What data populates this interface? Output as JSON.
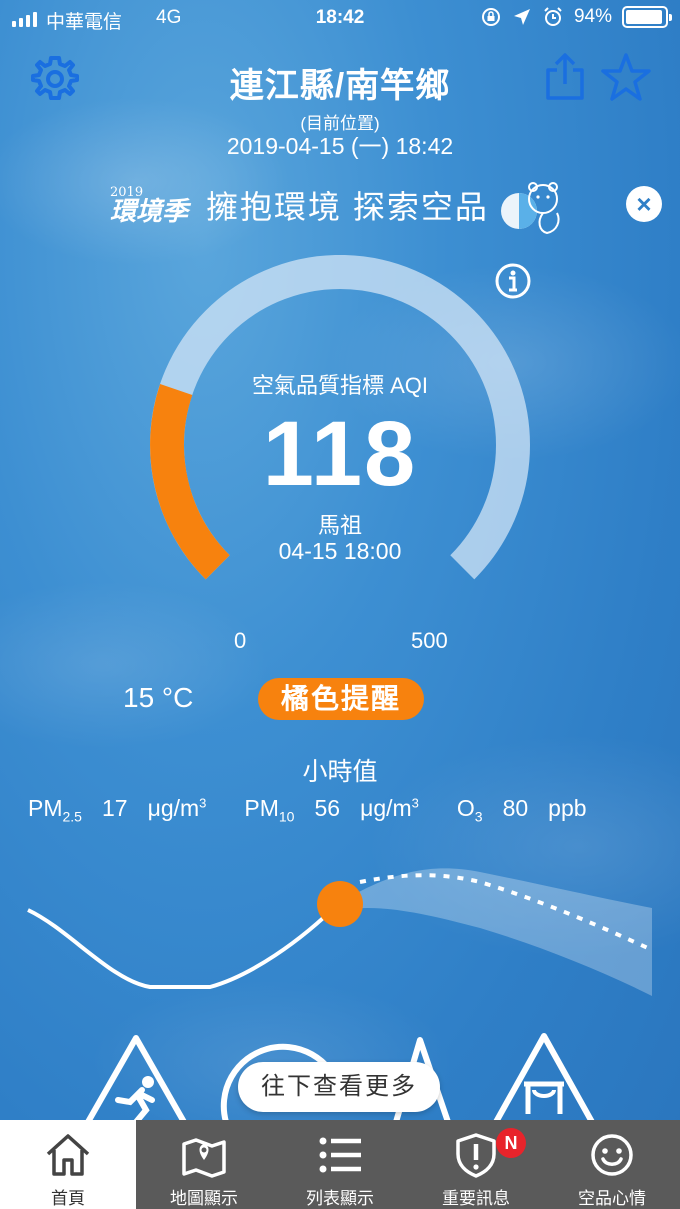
{
  "status_bar": {
    "carrier": "中華電信",
    "network": "4G",
    "time": "18:42",
    "battery": "94%",
    "battery_level": 0.94
  },
  "header": {
    "title": "連江縣/南竿鄉",
    "location_note": "(目前位置)",
    "datetime": "2019-04-15 (一) 18:42"
  },
  "banner": {
    "logo_year": "2019",
    "logo_text": "環境季",
    "text": "擁抱環境 探索空品"
  },
  "aqi": {
    "label": "空氣品質指標 AQI",
    "value": "118",
    "value_num": 118,
    "station": "馬祖",
    "time": "04-15 18:00",
    "min": "0",
    "max": "500",
    "max_num": 500,
    "level_color": "#f7820e"
  },
  "weather": {
    "temperature": "15 °C",
    "alert": "橘色提醒"
  },
  "hourly": {
    "title": "小時值",
    "pm25": {
      "name": "PM",
      "sub": "2.5",
      "value": "17",
      "unit": "μg/m",
      "unit_sup": "3"
    },
    "pm10": {
      "name": "PM",
      "sub": "10",
      "value": "56",
      "unit": "μg/m",
      "unit_sup": "3"
    },
    "o3": {
      "name": "O",
      "sub": "3",
      "value": "80",
      "unit": "ppb"
    }
  },
  "more_button": "往下查看更多",
  "tabs": [
    {
      "label": "首頁",
      "icon": "home-icon"
    },
    {
      "label": "地圖顯示",
      "icon": "map-icon"
    },
    {
      "label": "列表顯示",
      "icon": "list-icon"
    },
    {
      "label": "重要訊息",
      "icon": "shield-alert-icon",
      "badge": "N"
    },
    {
      "label": "空品心情",
      "icon": "smiley-icon"
    }
  ],
  "colors": {
    "accent": "#f7820e",
    "icon_blue": "#1a6fe0",
    "tabbar": "#5a5a5a"
  }
}
